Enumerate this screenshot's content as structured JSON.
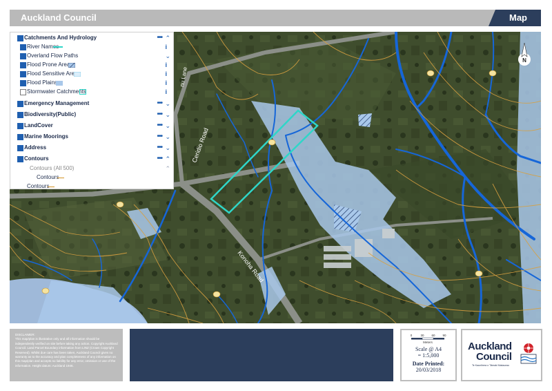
{
  "header": {
    "organisation": "Auckland Council",
    "doc_type": "Map"
  },
  "legend": {
    "groups": [
      {
        "label": "Catchments And Hydrology",
        "checked": true
      },
      {
        "label": "River Names",
        "checked": true
      },
      {
        "label": "Overland Flow Paths",
        "checked": true
      },
      {
        "label": "Flood Prone Areas",
        "checked": true
      },
      {
        "label": "Flood Sensitive Areas",
        "checked": true
      },
      {
        "label": "Flood Plains",
        "checked": true
      },
      {
        "label": "Stormwater Catchments",
        "checked": false
      },
      {
        "label": "Emergency Management",
        "checked": false
      },
      {
        "label": "Biodiversity(Public)",
        "checked": false
      },
      {
        "label": "LandCover",
        "checked": false
      },
      {
        "label": "Marine Moorings",
        "checked": false
      },
      {
        "label": "Address",
        "checked": false
      },
      {
        "label": "Contours",
        "checked": true
      },
      {
        "label": "Contours (All 500)",
        "checked": false
      },
      {
        "label": "Contours",
        "checked": false
      },
      {
        "label": "Contours",
        "checked": false
      }
    ]
  },
  "map": {
    "road_labels": [
      "Ceridio Road",
      "Konoha Road",
      "nu Lane"
    ],
    "colors": {
      "water": "#1666d8",
      "flood": "#a9c8ea",
      "contour": "#d8a040",
      "parcel": "#2fd6c8",
      "ground": "#3d4a2c"
    }
  },
  "footer": {
    "disclaimer_title": "DISCLAIMER:",
    "disclaimer_text": "This map/plan is illustrative only and all information should be independently verified on site before taking any action. Copyright Auckland Council. Land Parcel Boundary information from LINZ (Crown Copyright Reserved). Whilst due care has been taken, Auckland Council gives no warranty as to the accuracy and plan completeness of any information on this map/plan and accepts no liability for any error, omission or use of the information. Height datum: Auckland 1946.",
    "scale_ticks": [
      "0",
      "30",
      "60",
      "90"
    ],
    "scale_unit": "Meters",
    "scale_line1": "Scale @ A4",
    "scale_line2": "= 1:5,000",
    "date_label": "Date Printed:",
    "date_value": "20/03/2018",
    "logo_line1": "Auckland",
    "logo_line2": "Council",
    "logo_sub": "Te Kaunihera o Tāmaki Makaurau"
  },
  "north_label": "N"
}
